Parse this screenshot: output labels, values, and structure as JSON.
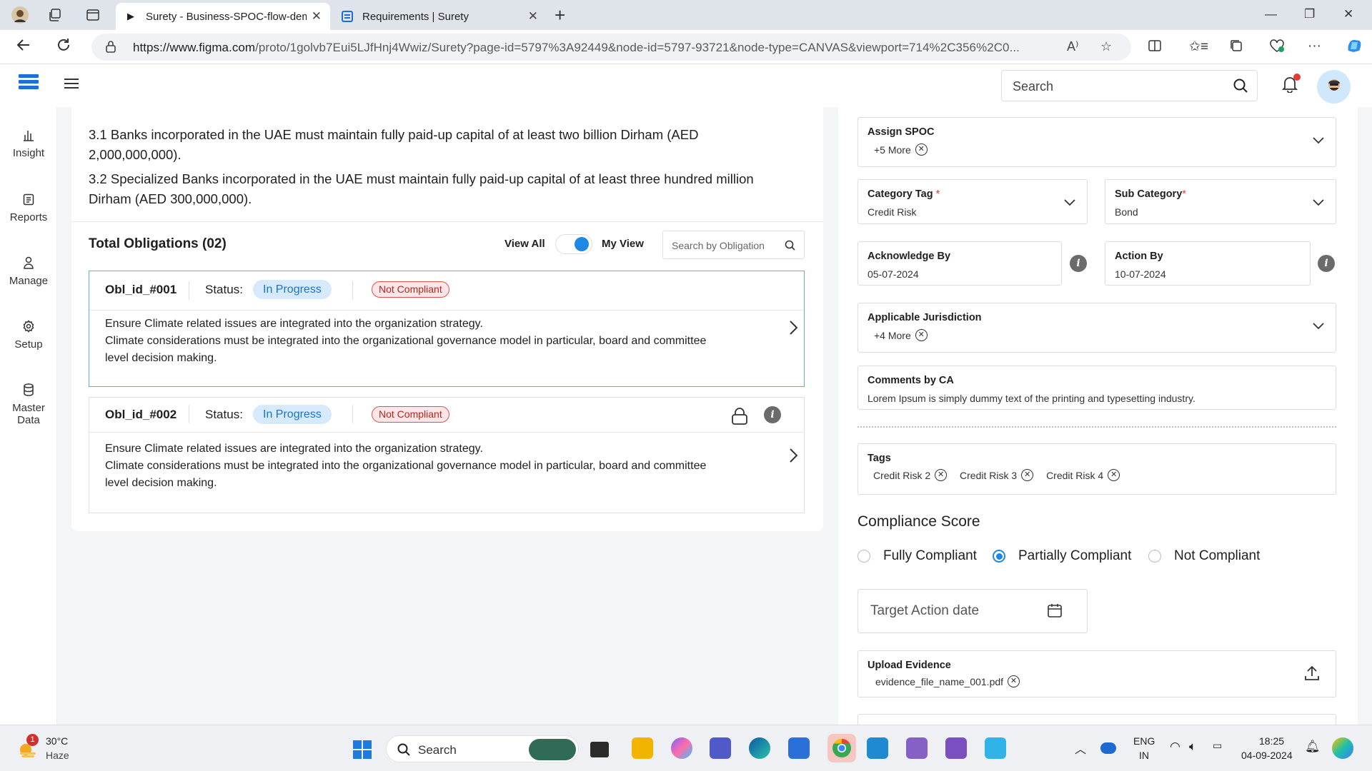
{
  "browser": {
    "tabs": [
      {
        "label": "Surety - Business-SPOC-flow-dem",
        "active": true
      },
      {
        "label": "Requirements | Surety",
        "active": false
      }
    ],
    "url_host": "https://www.figma.com",
    "url_path": "/proto/1golvb7Eui5LJfHnj4Wwiz/Surety?page-id=5797%3A92449&node-id=5797-93721&node-type=CANVAS&viewport=714%2C356%2C0..."
  },
  "header": {
    "search_placeholder": "Search"
  },
  "sidebar": {
    "items": [
      {
        "label": "Insight",
        "icon": "bar-chart-icon"
      },
      {
        "label": "Reports",
        "icon": "clipboard-icon"
      },
      {
        "label": "Manage",
        "icon": "user-icon"
      },
      {
        "label": "Setup",
        "icon": "gear-icon"
      },
      {
        "label": "Master Data",
        "icon": "database-icon"
      }
    ]
  },
  "main": {
    "paragraphs": [
      "3.1 Banks incorporated in the UAE must maintain fully paid-up capital of at least two billion Dirham (AED 2,000,000,000).",
      "3.2  Specialized Banks incorporated in the UAE must maintain fully paid-up capital of at least three hundred million Dirham (AED 300,000,000)."
    ],
    "obligations_title": "Total Obligations (02)",
    "view_all": "View All",
    "my_view": "My View",
    "obligation_search_placeholder": "Search by Obligation",
    "obligations": [
      {
        "id": "Obl_id_#001",
        "status_label": "Status:",
        "status": "In Progress",
        "compliance": "Not Compliant",
        "lines": [
          "Ensure Climate related issues are integrated into the organization strategy.",
          "Climate considerations must be integrated into the organizational governance model in particular, board and committee",
          "level decision making."
        ]
      },
      {
        "id": "Obl_id_#002",
        "status_label": "Status:",
        "status": "In Progress",
        "compliance": "Not Compliant",
        "lines": [
          "Ensure Climate related issues are integrated into the organization strategy.",
          "Climate considerations must be integrated into the organizational governance model in particular, board and committee",
          "level decision making."
        ]
      }
    ]
  },
  "panel": {
    "assign_spoc": {
      "label": "Assign SPOC",
      "chip": "+5 More"
    },
    "category_tag": {
      "label": "Category Tag",
      "value": "Credit Risk"
    },
    "sub_category": {
      "label": "Sub Category",
      "value": "Bond"
    },
    "acknowledge_by": {
      "label": "Acknowledge By",
      "value": "05-07-2024"
    },
    "action_by": {
      "label": "Action  By",
      "value": "10-07-2024"
    },
    "jurisdiction": {
      "label": "Applicable Jurisdiction",
      "chip": "+4 More"
    },
    "comments": {
      "label": "Comments by CA",
      "value": "Lorem Ipsum is simply dummy text of the printing and typesetting industry."
    },
    "tags": {
      "label": "Tags",
      "items": [
        "Credit Risk 2",
        "Credit Risk 3",
        "Credit Risk 4"
      ]
    },
    "compliance_score": {
      "title": "Compliance  Score",
      "options": [
        "Fully Compliant",
        "Partially Compliant",
        "Not Compliant"
      ],
      "selected": "Partially Compliant"
    },
    "target_action_placeholder": "Target Action date",
    "upload": {
      "label": "Upload Evidence",
      "file": "evidence_file_name_001.pdf"
    }
  },
  "taskbar": {
    "weather_temp": "30°C",
    "weather_desc": "Haze",
    "weather_badge": "1",
    "search_placeholder": "Search",
    "lang": "ENG",
    "region": "IN",
    "time": "18:25",
    "date": "04-09-2024"
  },
  "colors": {
    "accent": "#1e88e5",
    "in_progress_bg": "#d6eafc",
    "not_compliant": "#d9534f"
  }
}
